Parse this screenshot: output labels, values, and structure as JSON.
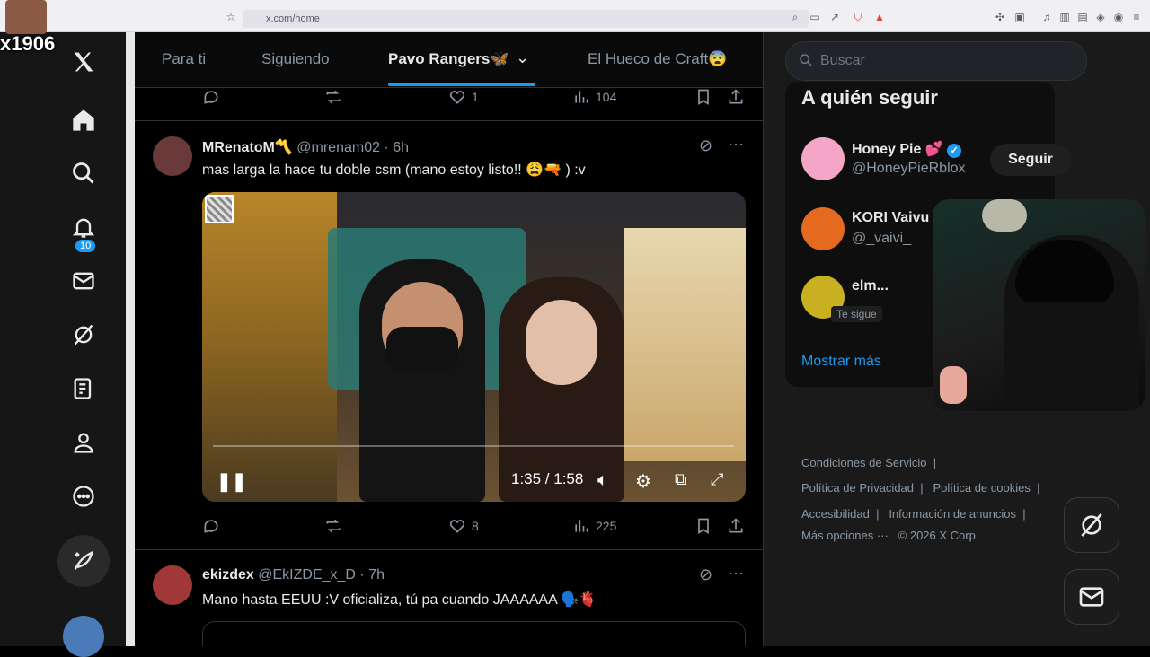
{
  "browser": {
    "url": "x.com/home"
  },
  "overlay": {
    "streamer_tag": "x1906"
  },
  "nav": {
    "notifications_badge": "10"
  },
  "tabs": [
    {
      "label": "Para ti"
    },
    {
      "label": "Siguiendo"
    },
    {
      "label": "Pavo Rangers🦋"
    },
    {
      "label": "El Hueco de Craft😨"
    }
  ],
  "prev_tweet_actions": {
    "likes": "1",
    "views": "104"
  },
  "tweet1": {
    "name": "MRenatoM〽️",
    "meta": "@mrenam02 · 6h",
    "text": "mas larga la hace tu doble csm (mano estoy listo!! 😩🔫 ) :v",
    "video_time": "1:35 / 1:58",
    "likes": "8",
    "views": "225"
  },
  "tweet2": {
    "name": "ekizdex",
    "meta": "@EkIZDE_x_D · 7h",
    "text": "Mano hasta EEUU :V oficializa, tú pa cuando JAAAAAA 🗣️🫀"
  },
  "right": {
    "search_placeholder": "Buscar",
    "wtf_title": "A quién seguir",
    "users": [
      {
        "name": "Honey Pie 💕",
        "handle": "@HoneyPieRblox",
        "color": "#f4a6c6"
      },
      {
        "name": "KORI Vaivu",
        "handle": "@_vaivi_",
        "color": "#e36a1f"
      },
      {
        "name": "elm...",
        "handle": "",
        "color": "#c8b020"
      }
    ],
    "follow_label": "Seguir",
    "follows_you": "Te sigue",
    "show_more": "Mostrar más",
    "footer": {
      "terms": "Condiciones de Servicio",
      "privacy": "Política de Privacidad",
      "cookies": "Política de cookies",
      "accessibility": "Accesibilidad",
      "ads": "Información de anuncios",
      "more": "Más opciones ···",
      "copyright": "© 2026 X Corp."
    }
  },
  "colors": {
    "accent": "#1d9bf0",
    "background": "#000000"
  }
}
